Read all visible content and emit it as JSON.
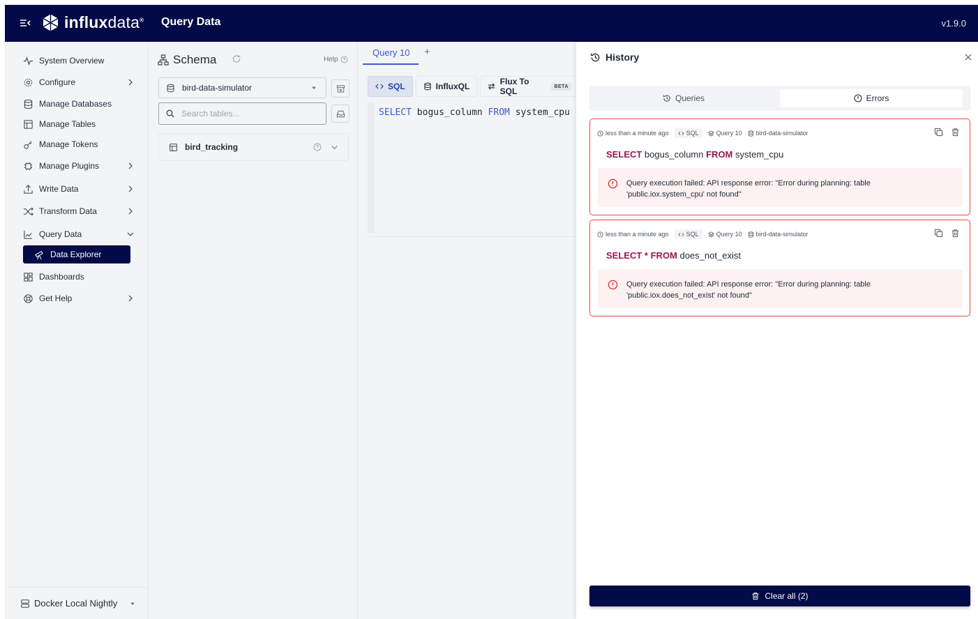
{
  "topbar": {
    "logo_bold": "influx",
    "logo_light": "data",
    "logo_reg": "®",
    "title": "Query Data",
    "version": "v1.9.0"
  },
  "sidebar": {
    "items": [
      {
        "label": "System Overview",
        "icon": "activity-icon",
        "chevron": false
      },
      {
        "label": "Configure",
        "icon": "gear-icon",
        "chevron": "right"
      },
      {
        "label": "Manage Databases",
        "icon": "database-icon",
        "chevron": false
      },
      {
        "label": "Manage Tables",
        "icon": "table-icon",
        "chevron": false
      },
      {
        "label": "Manage Tokens",
        "icon": "key-icon",
        "chevron": false
      },
      {
        "label": "Manage Plugins",
        "icon": "plugin-icon",
        "chevron": "right"
      },
      {
        "label": "Write Data",
        "icon": "upload-icon",
        "chevron": "right"
      },
      {
        "label": "Transform Data",
        "icon": "shuffle-icon",
        "chevron": "right"
      },
      {
        "label": "Query Data",
        "icon": "chart-line-icon",
        "chevron": "down"
      },
      {
        "label": "Data Explorer",
        "icon": "telescope-icon",
        "chevron": false
      },
      {
        "label": "Dashboards",
        "icon": "dashboard-icon",
        "chevron": false
      },
      {
        "label": "Get Help",
        "icon": "lifebuoy-icon",
        "chevron": "right"
      }
    ],
    "footer": "Docker Local Nightly"
  },
  "schema": {
    "title": "Schema",
    "help": "Help",
    "database": "bird-data-simulator",
    "search_placeholder": "Search tables...",
    "table": "bird_tracking"
  },
  "editor": {
    "tab_label": "Query 10",
    "tab_add": "+",
    "lang_tabs": [
      "SQL",
      "InfluxQL",
      "Flux To SQL"
    ],
    "beta": "BETA",
    "code": {
      "kw1": "SELECT",
      "col": "bogus_column",
      "kw2": "FROM",
      "table": "system_cpu"
    }
  },
  "history": {
    "title": "History",
    "tabs": [
      "Queries",
      "Errors"
    ],
    "active_tab": "Errors",
    "cards": [
      {
        "time": "less than a minute ago",
        "lang": "SQL",
        "query_name": "Query 10",
        "database": "bird-data-simulator",
        "kw1": "SELECT",
        "mid": "bogus_column",
        "kw2": "FROM",
        "tail": "system_cpu",
        "error": "Query execution failed: API response error: \"Error during planning: table 'public.iox.system_cpu' not found\""
      },
      {
        "time": "less than a minute ago",
        "lang": "SQL",
        "query_name": "Query 10",
        "database": "bird-data-simulator",
        "kw1": "SELECT",
        "mid": "*",
        "kw2": "FROM",
        "tail": "does_not_exist",
        "error": "Query execution failed: API response error: \"Error during planning: table 'public.iox.does_not_exist' not found\""
      }
    ],
    "clear_label": "Clear all (2)"
  },
  "colors": {
    "navy": "#020a47",
    "accent": "#3b5bcc",
    "error": "#ef4444",
    "keyword": "#9d174d"
  }
}
